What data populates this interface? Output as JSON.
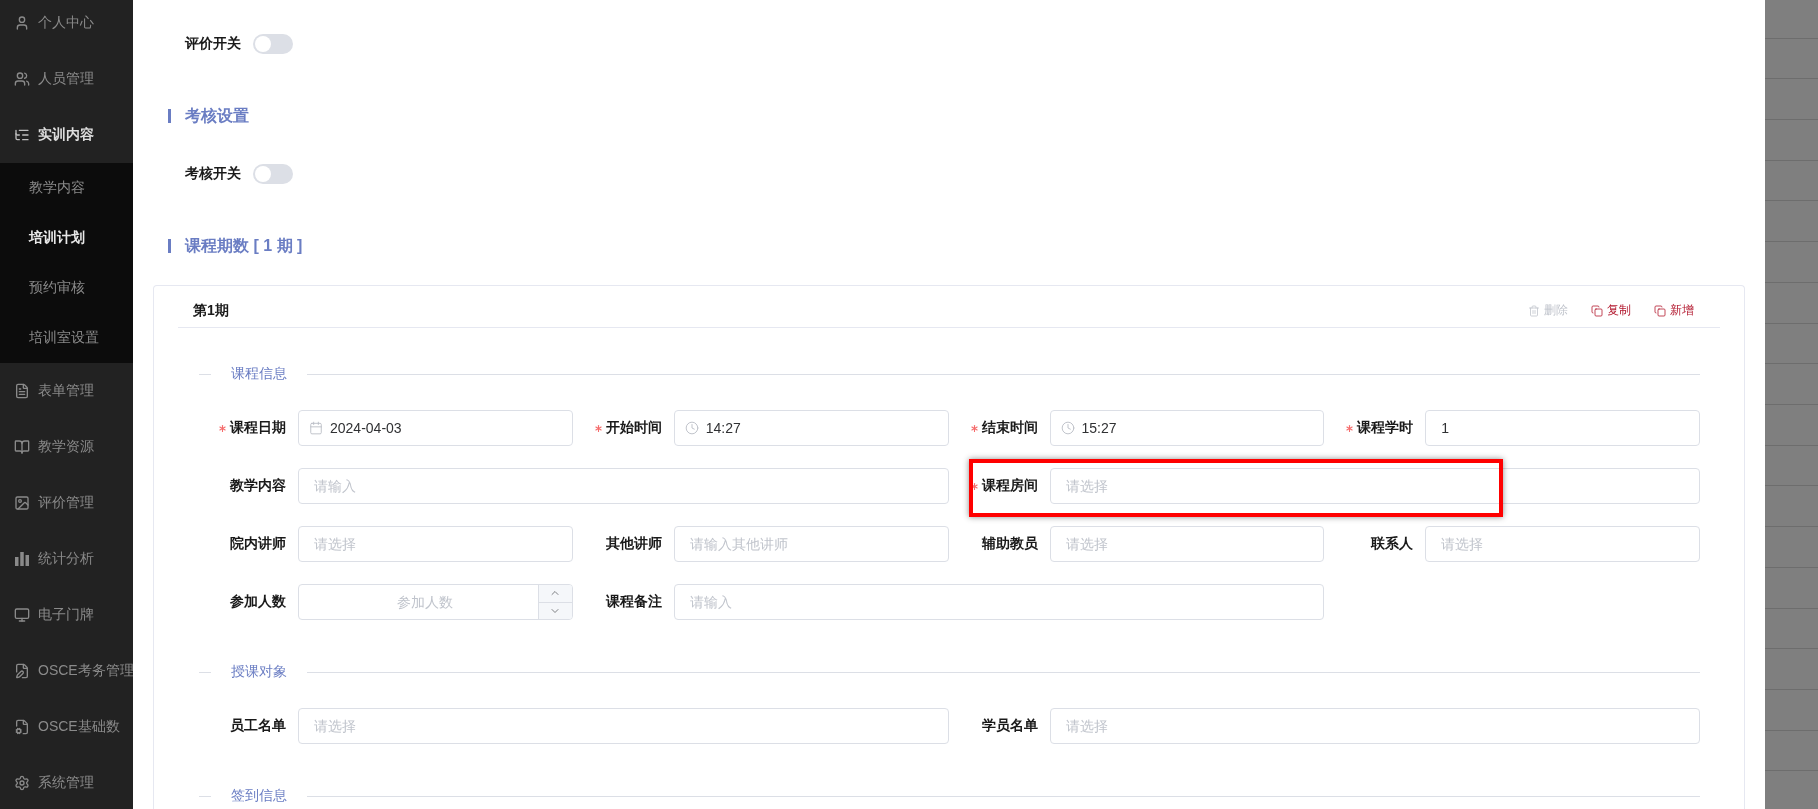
{
  "sidebar": {
    "items": [
      {
        "label": "个人中心",
        "selected": false
      },
      {
        "label": "人员管理",
        "selected": false
      },
      {
        "label": "实训内容",
        "selected": true,
        "expanded": true,
        "children": [
          {
            "label": "教学内容",
            "selected": false
          },
          {
            "label": "培训计划",
            "selected": true
          },
          {
            "label": "预约审核",
            "selected": false
          },
          {
            "label": "培训室设置",
            "selected": false
          }
        ]
      },
      {
        "label": "表单管理",
        "selected": false
      },
      {
        "label": "教学资源",
        "selected": false
      },
      {
        "label": "评价管理",
        "selected": false
      },
      {
        "label": "统计分析",
        "selected": false
      },
      {
        "label": "电子门牌",
        "selected": false
      },
      {
        "label": "OSCE考务管理",
        "selected": false
      },
      {
        "label": "OSCE基础数",
        "selected": false
      },
      {
        "label": "系统管理",
        "selected": false
      }
    ]
  },
  "evaluation": {
    "switch": {
      "label": "评价开关",
      "on": false
    }
  },
  "assessment": {
    "title": "考核设置",
    "switch": {
      "label": "考核开关",
      "on": false
    }
  },
  "periods": {
    "title": "课程期数 [ 1 期 ]",
    "cards": [
      {
        "title": "第1期",
        "actions": [
          {
            "label": "删除",
            "disabled": true
          },
          {
            "label": "复制",
            "disabled": false
          },
          {
            "label": "新增",
            "disabled": false
          }
        ],
        "groups": [
          {
            "title": "课程信息",
            "fields": [
              {
                "label": "课程日期",
                "kind": "date",
                "value": "2024-04-03",
                "required": true,
                "wide": false,
                "highlighted": false
              },
              {
                "label": "开始时间",
                "kind": "time",
                "value": "14:27",
                "required": true,
                "wide": false,
                "highlighted": false
              },
              {
                "label": "结束时间",
                "kind": "time",
                "value": "15:27",
                "required": true,
                "wide": false,
                "highlighted": false
              },
              {
                "label": "课程学时",
                "kind": "text",
                "value": "1",
                "required": true,
                "wide": false,
                "highlighted": false
              },
              {
                "label": "教学内容",
                "kind": "text",
                "placeholder": "请输入",
                "required": false,
                "wide": true,
                "highlighted": false
              },
              {
                "label": "课程房间",
                "kind": "text",
                "placeholder": "请选择",
                "required": true,
                "wide": true,
                "highlighted": true
              },
              {
                "label": "院内讲师",
                "kind": "text",
                "placeholder": "请选择",
                "required": false,
                "wide": false,
                "highlighted": false
              },
              {
                "label": "其他讲师",
                "kind": "text",
                "placeholder": "请输入其他讲师",
                "required": false,
                "wide": false,
                "highlighted": false
              },
              {
                "label": "辅助教员",
                "kind": "text",
                "placeholder": "请选择",
                "required": false,
                "wide": false,
                "highlighted": false
              },
              {
                "label": "联系人",
                "kind": "text",
                "placeholder": "请选择",
                "required": false,
                "wide": false,
                "highlighted": false
              },
              {
                "label": "参加人数",
                "kind": "number",
                "placeholder": "参加人数",
                "required": false,
                "wide": false,
                "highlighted": false
              },
              {
                "label": "课程备注",
                "kind": "text",
                "placeholder": "请输入",
                "required": false,
                "wide": true,
                "highlighted": false
              }
            ]
          },
          {
            "title": "授课对象",
            "fields": [
              {
                "label": "员工名单",
                "kind": "text",
                "placeholder": "请选择",
                "required": false,
                "wide": true,
                "highlighted": false
              },
              {
                "label": "学员名单",
                "kind": "text",
                "placeholder": "请选择",
                "required": false,
                "wide": true,
                "highlighted": false
              }
            ]
          },
          {
            "title": "签到信息"
          }
        ]
      }
    ]
  }
}
